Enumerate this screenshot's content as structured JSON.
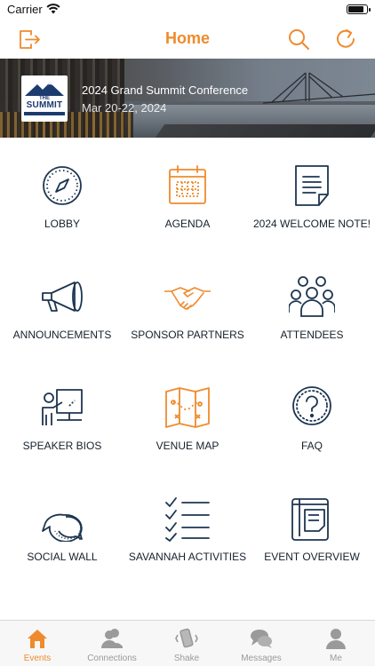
{
  "status_bar": {
    "carrier": "Carrier"
  },
  "nav": {
    "title": "Home",
    "logout_icon": "logout-icon",
    "search_icon": "search-icon",
    "refresh_icon": "refresh-icon",
    "accent_color": "#ef8b2c"
  },
  "banner": {
    "event_title": "2024 Grand Summit Conference",
    "event_dates": "Mar 20-22, 2024",
    "logo": {
      "line1": "THE",
      "line2": "SUMMIT"
    }
  },
  "grid": {
    "tiles": [
      {
        "label": "LOBBY",
        "icon": "compass-icon"
      },
      {
        "label": "AGENDA",
        "icon": "calendar-icon"
      },
      {
        "label": "2024 WELCOME NOTE!",
        "icon": "document-icon"
      },
      {
        "label": "ANNOUNCEMENTS",
        "icon": "megaphone-icon"
      },
      {
        "label": "SPONSOR PARTNERS",
        "icon": "handshake-icon"
      },
      {
        "label": "ATTENDEES",
        "icon": "people-group-icon"
      },
      {
        "label": "SPEAKER BIOS",
        "icon": "presenter-icon"
      },
      {
        "label": "VENUE MAP",
        "icon": "map-icon"
      },
      {
        "label": "FAQ",
        "icon": "question-icon"
      },
      {
        "label": "SOCIAL WALL",
        "icon": "chat-bubbles-icon"
      },
      {
        "label": "SAVANNAH ACTIVITIES",
        "icon": "checklist-icon"
      },
      {
        "label": "EVENT OVERVIEW",
        "icon": "clipboard-icon"
      }
    ]
  },
  "tab_bar": {
    "tabs": [
      {
        "label": "Events",
        "icon": "home-icon",
        "active": true
      },
      {
        "label": "Connections",
        "icon": "connections-icon",
        "active": false
      },
      {
        "label": "Shake",
        "icon": "shake-phone-icon",
        "active": false
      },
      {
        "label": "Messages",
        "icon": "messages-icon",
        "active": false
      },
      {
        "label": "Me",
        "icon": "profile-icon",
        "active": false
      }
    ]
  },
  "colors": {
    "accent": "#ef8b2c",
    "navy": "#1d3550",
    "tab_inactive": "#9a9a9a"
  }
}
